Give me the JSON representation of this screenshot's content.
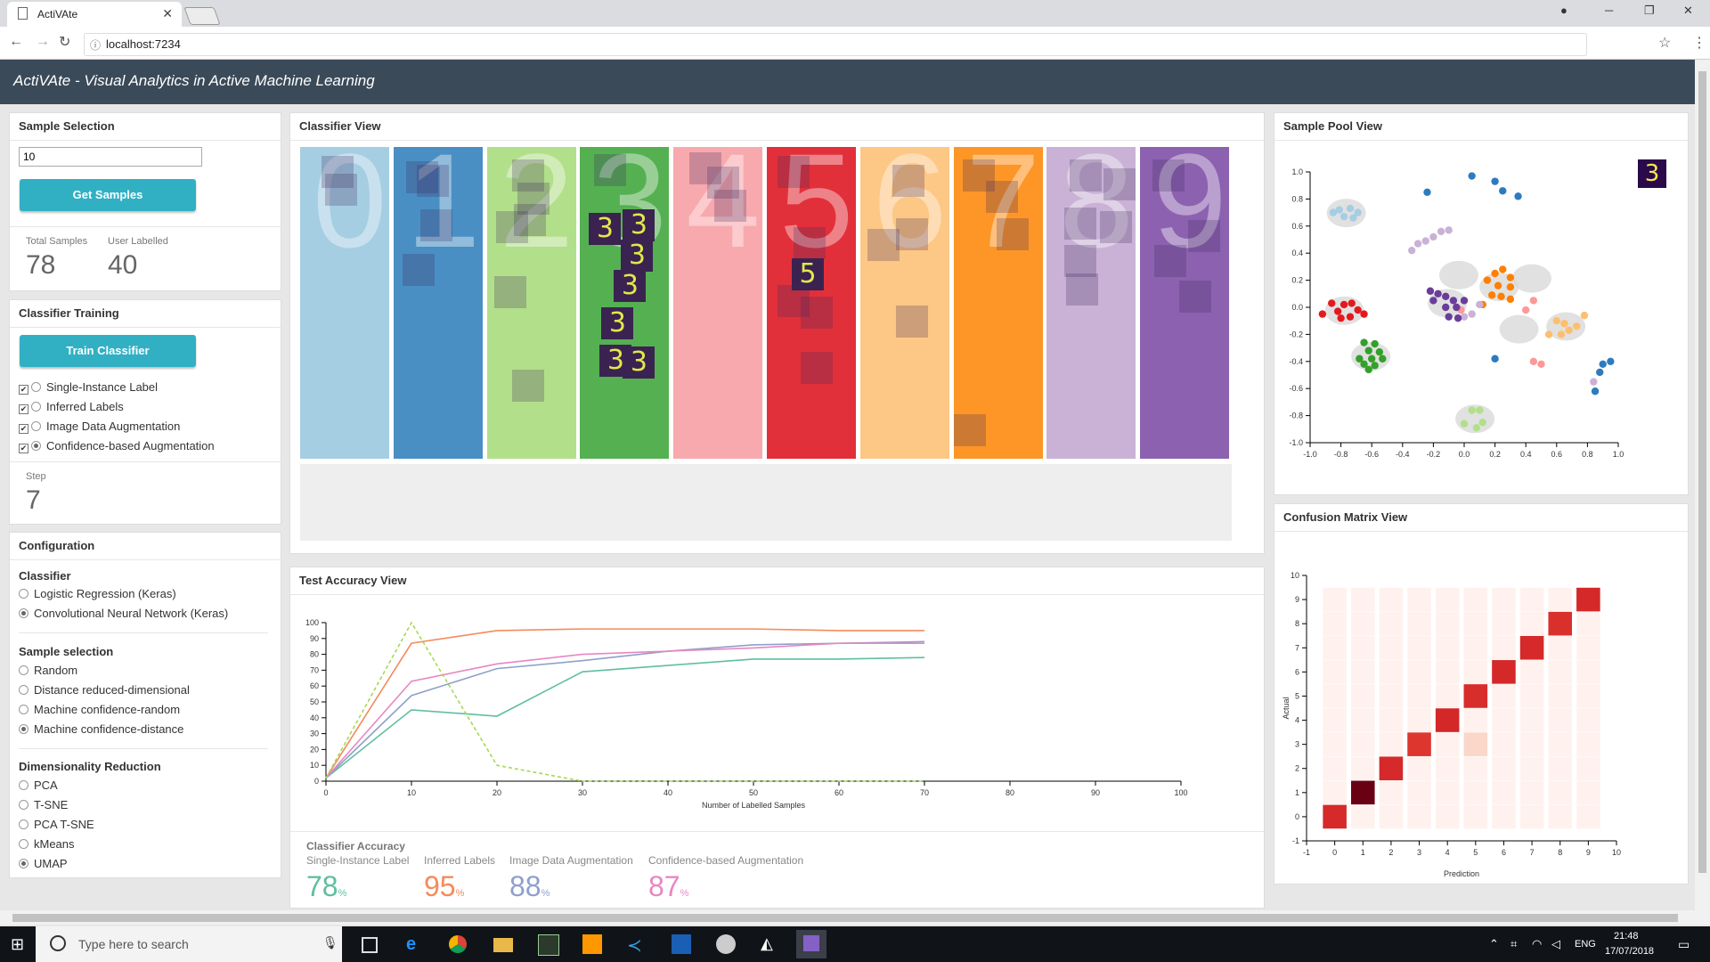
{
  "browser": {
    "tab_title": "ActiVAte",
    "url": "localhost:7234"
  },
  "app": {
    "title": "ActiVAte - Visual Analytics in Active Machine Learning"
  },
  "sample_selection": {
    "header": "Sample Selection",
    "input_value": "10",
    "get_samples_label": "Get Samples",
    "total_samples_label": "Total Samples",
    "total_samples_value": "78",
    "user_labelled_label": "User Labelled",
    "user_labelled_value": "40"
  },
  "classifier_training": {
    "header": "Classifier Training",
    "train_label": "Train Classifier",
    "options": [
      {
        "label": "Single-Instance Label",
        "checked": true,
        "radio": false
      },
      {
        "label": "Inferred Labels",
        "checked": true,
        "radio": false
      },
      {
        "label": "Image Data Augmentation",
        "checked": true,
        "radio": false
      },
      {
        "label": "Confidence-based Augmentation",
        "checked": true,
        "radio": true
      }
    ],
    "step_label": "Step",
    "step_value": "7"
  },
  "configuration": {
    "header": "Configuration",
    "classifier_title": "Classifier",
    "classifier_options": [
      {
        "label": "Logistic Regression (Keras)",
        "selected": false
      },
      {
        "label": "Convolutional Neural Network (Keras)",
        "selected": true
      }
    ],
    "sampling_title": "Sample selection",
    "sampling_options": [
      {
        "label": "Random",
        "selected": false
      },
      {
        "label": "Distance reduced-dimensional",
        "selected": false
      },
      {
        "label": "Machine confidence-random",
        "selected": false
      },
      {
        "label": "Machine confidence-distance",
        "selected": true
      }
    ],
    "dimred_title": "Dimensionality Reduction",
    "dimred_options": [
      {
        "label": "PCA",
        "selected": false
      },
      {
        "label": "T-SNE",
        "selected": false
      },
      {
        "label": "PCA T-SNE",
        "selected": false
      },
      {
        "label": "kMeans",
        "selected": false
      },
      {
        "label": "UMAP",
        "selected": true
      }
    ]
  },
  "classifier_view": {
    "header": "Classifier View",
    "classes": [
      {
        "digit": "0",
        "color": "#a6cee3"
      },
      {
        "digit": "1",
        "color": "#4a8fc4"
      },
      {
        "digit": "2",
        "color": "#b2df8a"
      },
      {
        "digit": "3",
        "color": "#55b052"
      },
      {
        "digit": "4",
        "color": "#f8a9ad"
      },
      {
        "digit": "5",
        "color": "#e2303a"
      },
      {
        "digit": "6",
        "color": "#fdc785"
      },
      {
        "digit": "7",
        "color": "#fd9626"
      },
      {
        "digit": "8",
        "color": "#cab2d6"
      },
      {
        "digit": "9",
        "color": "#8c62b0"
      }
    ]
  },
  "sample_pool_view": {
    "header": "Sample Pool View",
    "preview_digit": "3"
  },
  "confusion_matrix_view": {
    "header": "Confusion Matrix View",
    "xlabel": "Prediction",
    "ylabel": "Actual"
  },
  "test_accuracy_view": {
    "header": "Test Accuracy View",
    "accuracy_title": "Classifier Accuracy",
    "metrics": [
      {
        "label": "Single-Instance Label",
        "value": "78",
        "unit": "%",
        "color": "#5fbfa0"
      },
      {
        "label": "Inferred Labels",
        "value": "95",
        "unit": "%",
        "color": "#f48b5b"
      },
      {
        "label": "Image Data Augmentation",
        "value": "88",
        "unit": "%",
        "color": "#8ea0cb"
      },
      {
        "label": "Confidence-based Augmentation",
        "value": "87",
        "unit": "%",
        "color": "#e787c2"
      }
    ]
  },
  "chart_data": [
    {
      "type": "line",
      "xlabel": "Number of Labelled Samples",
      "ylabel": "",
      "xlim": [
        0,
        100
      ],
      "ylim": [
        0,
        100
      ],
      "xticks": [
        0,
        10,
        20,
        30,
        40,
        50,
        60,
        70,
        80,
        90,
        100
      ],
      "yticks": [
        0,
        10,
        20,
        30,
        40,
        50,
        60,
        70,
        80,
        90,
        100
      ],
      "series": [
        {
          "color": "#5fbfa0",
          "style": "solid",
          "x": [
            0,
            10,
            20,
            30,
            40,
            50,
            60,
            70
          ],
          "y": [
            2,
            45,
            41,
            69,
            73,
            77,
            77,
            78
          ]
        },
        {
          "color": "#f48b5b",
          "style": "solid",
          "x": [
            0,
            10,
            20,
            30,
            40,
            50,
            60,
            70
          ],
          "y": [
            2,
            87,
            95,
            96,
            96,
            96,
            95,
            95
          ]
        },
        {
          "color": "#8ea0cb",
          "style": "solid",
          "x": [
            0,
            10,
            20,
            30,
            40,
            50,
            60,
            70
          ],
          "y": [
            2,
            54,
            71,
            76,
            82,
            86,
            87,
            88
          ]
        },
        {
          "color": "#e787c2",
          "style": "solid",
          "x": [
            0,
            10,
            20,
            30,
            40,
            50,
            60,
            70
          ],
          "y": [
            2,
            63,
            74,
            80,
            82,
            84,
            87,
            87
          ]
        },
        {
          "color": "#a6d854",
          "style": "dashed",
          "x": [
            0,
            10,
            20,
            30,
            40,
            50,
            60,
            70
          ],
          "y": [
            2,
            100,
            10,
            0,
            0,
            0,
            0,
            0
          ]
        }
      ]
    },
    {
      "type": "scatter",
      "xlim": [
        -1.0,
        1.0
      ],
      "ylim": [
        -1.0,
        1.0
      ],
      "xticks": [
        "-1.0",
        "-0.8",
        "-0.6",
        "-0.4",
        "-0.2",
        "0.0",
        "0.2",
        "0.4",
        "0.6",
        "0.8",
        "1.0"
      ],
      "yticks": [
        "1.0",
        "0.8",
        "0.6",
        "0.4",
        "0.2",
        "0.0",
        "-0.2",
        "-0.4",
        "-0.6",
        "-0.8",
        "-1.0"
      ],
      "clusters": [
        {
          "digit": "0",
          "color": "#a6cee3",
          "points": [
            [
              -0.81,
              0.72
            ],
            [
              -0.74,
              0.73
            ],
            [
              -0.78,
              0.67
            ],
            [
              -0.72,
              0.66
            ],
            [
              -0.69,
              0.7
            ],
            [
              -0.85,
              0.7
            ]
          ]
        },
        {
          "digit": "1",
          "color": "#2d7bbf",
          "points": [
            [
              0.05,
              0.97
            ],
            [
              0.2,
              0.93
            ],
            [
              0.25,
              0.86
            ],
            [
              0.35,
              0.82
            ],
            [
              -0.24,
              0.85
            ],
            [
              0.2,
              -0.38
            ],
            [
              0.9,
              -0.42
            ],
            [
              0.95,
              -0.4
            ],
            [
              0.88,
              -0.48
            ],
            [
              0.85,
              -0.62
            ]
          ]
        },
        {
          "digit": "2",
          "color": "#b2df8a",
          "points": [
            [
              0.05,
              -0.76
            ],
            [
              0.1,
              -0.76
            ],
            [
              0.0,
              -0.86
            ],
            [
              0.08,
              -0.89
            ],
            [
              0.12,
              -0.85
            ]
          ]
        },
        {
          "digit": "3",
          "color": "#33a02c",
          "points": [
            [
              -0.65,
              -0.26
            ],
            [
              -0.58,
              -0.27
            ],
            [
              -0.62,
              -0.32
            ],
            [
              -0.55,
              -0.33
            ],
            [
              -0.68,
              -0.38
            ],
            [
              -0.6,
              -0.38
            ],
            [
              -0.53,
              -0.38
            ],
            [
              -0.65,
              -0.42
            ],
            [
              -0.58,
              -0.43
            ],
            [
              -0.62,
              -0.46
            ]
          ]
        },
        {
          "digit": "4",
          "color": "#fb9a99",
          "points": [
            [
              0.45,
              0.05
            ],
            [
              0.4,
              -0.02
            ],
            [
              0.45,
              -0.4
            ],
            [
              0.5,
              -0.42
            ],
            [
              -0.02,
              -0.02
            ]
          ]
        },
        {
          "digit": "5",
          "color": "#e31a1c",
          "points": [
            [
              -0.92,
              -0.05
            ],
            [
              -0.86,
              0.03
            ],
            [
              -0.82,
              -0.03
            ],
            [
              -0.78,
              0.02
            ],
            [
              -0.73,
              0.03
            ],
            [
              -0.69,
              -0.02
            ],
            [
              -0.65,
              -0.05
            ],
            [
              -0.74,
              -0.07
            ],
            [
              -0.8,
              -0.08
            ]
          ]
        },
        {
          "digit": "6",
          "color": "#fdbf6f",
          "points": [
            [
              0.6,
              -0.1
            ],
            [
              0.65,
              -0.12
            ],
            [
              0.68,
              -0.17
            ],
            [
              0.63,
              -0.2
            ],
            [
              0.55,
              -0.2
            ],
            [
              0.73,
              -0.14
            ],
            [
              0.78,
              -0.06
            ]
          ]
        },
        {
          "digit": "7",
          "color": "#ff7f00",
          "points": [
            [
              0.2,
              0.25
            ],
            [
              0.25,
              0.28
            ],
            [
              0.3,
              0.22
            ],
            [
              0.15,
              0.2
            ],
            [
              0.22,
              0.16
            ],
            [
              0.3,
              0.15
            ],
            [
              0.18,
              0.09
            ],
            [
              0.24,
              0.08
            ],
            [
              0.3,
              0.06
            ],
            [
              0.12,
              0.02
            ]
          ]
        },
        {
          "digit": "8",
          "color": "#cab2d6",
          "points": [
            [
              -0.34,
              0.42
            ],
            [
              -0.3,
              0.47
            ],
            [
              -0.25,
              0.49
            ],
            [
              -0.2,
              0.52
            ],
            [
              -0.15,
              0.56
            ],
            [
              -0.1,
              0.57
            ],
            [
              0.1,
              0.02
            ],
            [
              0.05,
              -0.05
            ],
            [
              0.0,
              -0.07
            ],
            [
              0.84,
              -0.55
            ]
          ]
        },
        {
          "digit": "9",
          "color": "#6a3d9a",
          "points": [
            [
              -0.22,
              0.12
            ],
            [
              -0.17,
              0.1
            ],
            [
              -0.12,
              0.08
            ],
            [
              -0.07,
              0.05
            ],
            [
              -0.2,
              0.05
            ],
            [
              -0.12,
              0.0
            ],
            [
              -0.05,
              0.0
            ],
            [
              -0.1,
              -0.07
            ],
            [
              -0.04,
              -0.08
            ],
            [
              0.0,
              0.05
            ]
          ]
        }
      ]
    },
    {
      "type": "heatmap",
      "xlabel": "Prediction",
      "ylabel": "Actual",
      "xlim": [
        -1,
        10
      ],
      "ylim": [
        -1,
        10
      ],
      "xticks": [
        -1,
        0,
        1,
        2,
        3,
        4,
        5,
        6,
        7,
        8,
        9,
        10
      ],
      "yticks": [
        -1,
        0,
        1,
        2,
        3,
        4,
        5,
        6,
        7,
        8,
        9,
        10
      ],
      "matrix": [
        [
          0.8,
          0.05,
          0.05,
          0.05,
          0.05,
          0.05,
          0.05,
          0.05,
          0.05,
          0.05
        ],
        [
          0.05,
          1.0,
          0.05,
          0.05,
          0.05,
          0.05,
          0.05,
          0.05,
          0.05,
          0.05
        ],
        [
          0.05,
          0.05,
          0.8,
          0.05,
          0.05,
          0.05,
          0.05,
          0.05,
          0.05,
          0.05
        ],
        [
          0.05,
          0.05,
          0.05,
          0.6,
          0.05,
          0.2,
          0.05,
          0.05,
          0.05,
          0.05
        ],
        [
          0.05,
          0.05,
          0.05,
          0.05,
          0.85,
          0.05,
          0.05,
          0.05,
          0.05,
          0.05
        ],
        [
          0.05,
          0.05,
          0.05,
          0.05,
          0.05,
          0.75,
          0.05,
          0.05,
          0.05,
          0.05
        ],
        [
          0.05,
          0.05,
          0.05,
          0.05,
          0.05,
          0.05,
          0.82,
          0.05,
          0.05,
          0.05
        ],
        [
          0.05,
          0.05,
          0.05,
          0.05,
          0.05,
          0.05,
          0.05,
          0.8,
          0.05,
          0.05
        ],
        [
          0.05,
          0.05,
          0.05,
          0.05,
          0.05,
          0.05,
          0.05,
          0.05,
          0.7,
          0.05
        ],
        [
          0.05,
          0.05,
          0.05,
          0.05,
          0.05,
          0.05,
          0.05,
          0.05,
          0.05,
          0.82
        ]
      ]
    }
  ],
  "taskbar": {
    "search_placeholder": "Type here to search",
    "lang": "ENG",
    "time": "21:48",
    "date": "17/07/2018"
  }
}
